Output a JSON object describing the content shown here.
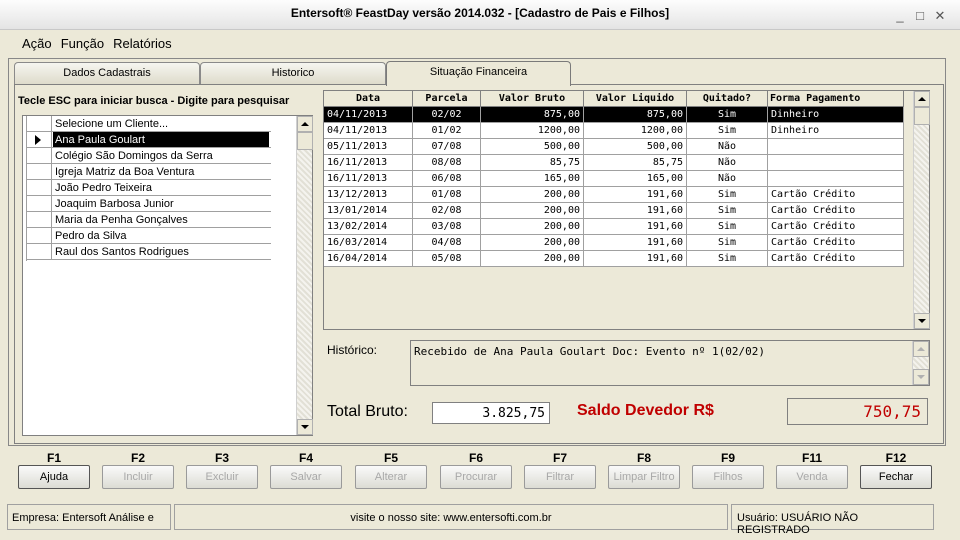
{
  "window": {
    "title": "Entersoft® FeastDay versão 2014.032 - [Cadastro de Pais e Filhos]"
  },
  "menu": [
    "Ação",
    "Função",
    "Relatórios"
  ],
  "tabs": [
    {
      "label": "Dados Cadastrais"
    },
    {
      "label": "Historico"
    },
    {
      "label": "Situação Financeira"
    }
  ],
  "search_instruction": "Tecle ESC para iniciar busca - Digite para pesquisar",
  "clients": {
    "header": "Selecione um Cliente...",
    "items": [
      "Ana Paula Goulart",
      "Colégio São Domingos da Serra",
      "Igreja Matriz da Boa Ventura",
      "João Pedro Teixeira",
      "Joaquim Barbosa Junior",
      "Maria da Penha Gonçalves",
      "Pedro da Silva",
      "Raul dos Santos Rodrigues"
    ],
    "selected_index": 0
  },
  "finance": {
    "columns": [
      "Data",
      "Parcela",
      "Valor Bruto",
      "Valor Liquido",
      "Quitado?",
      "Forma Pagamento"
    ],
    "rows": [
      [
        "04/11/2013",
        "02/02",
        "875,00",
        "875,00",
        "Sim",
        "Dinheiro"
      ],
      [
        "04/11/2013",
        "01/02",
        "1200,00",
        "1200,00",
        "Sim",
        "Dinheiro"
      ],
      [
        "05/11/2013",
        "07/08",
        "500,00",
        "500,00",
        "Não",
        ""
      ],
      [
        "16/11/2013",
        "08/08",
        "85,75",
        "85,75",
        "Não",
        ""
      ],
      [
        "16/11/2013",
        "06/08",
        "165,00",
        "165,00",
        "Não",
        ""
      ],
      [
        "13/12/2013",
        "01/08",
        "200,00",
        "191,60",
        "Sim",
        "Cartão Crédito"
      ],
      [
        "13/01/2014",
        "02/08",
        "200,00",
        "191,60",
        "Sim",
        "Cartão Crédito"
      ],
      [
        "13/02/2014",
        "03/08",
        "200,00",
        "191,60",
        "Sim",
        "Cartão Crédito"
      ],
      [
        "16/03/2014",
        "04/08",
        "200,00",
        "191,60",
        "Sim",
        "Cartão Crédito"
      ],
      [
        "16/04/2014",
        "05/08",
        "200,00",
        "191,60",
        "Sim",
        "Cartão Crédito"
      ]
    ],
    "selected_index": 0
  },
  "historico": {
    "label": "Histórico:",
    "text": "Recebido de Ana Paula Goulart Doc: Evento nº 1(02/02)"
  },
  "totals": {
    "bruto_label": "Total Bruto:",
    "bruto_value": "3.825,75",
    "saldo_label": "Saldo Devedor R$",
    "saldo_value": "750,75"
  },
  "fkeys": [
    {
      "key": "F1",
      "label": "Ajuda",
      "enabled": true
    },
    {
      "key": "F2",
      "label": "Incluir",
      "enabled": false
    },
    {
      "key": "F3",
      "label": "Excluir",
      "enabled": false
    },
    {
      "key": "F4",
      "label": "Salvar",
      "enabled": false
    },
    {
      "key": "F5",
      "label": "Alterar",
      "enabled": false
    },
    {
      "key": "F6",
      "label": "Procurar",
      "enabled": false
    },
    {
      "key": "F7",
      "label": "Filtrar",
      "enabled": false
    },
    {
      "key": "F8",
      "label": "Limpar Filtro",
      "enabled": false
    },
    {
      "key": "F9",
      "label": "Filhos",
      "enabled": false
    },
    {
      "key": "F11",
      "label": "Venda",
      "enabled": false
    },
    {
      "key": "F12",
      "label": "Fechar",
      "enabled": true
    }
  ],
  "status": {
    "empresa": "Empresa: Entersoft Análise e",
    "site": "visite o nosso site: www.entersofti.com.br",
    "usuario": "Usuário: USUÁRIO NÃO REGISTRADO"
  },
  "colors": {
    "accent_red": "#c00000",
    "selection": "#000000",
    "window_bg": "#ece9d8"
  }
}
